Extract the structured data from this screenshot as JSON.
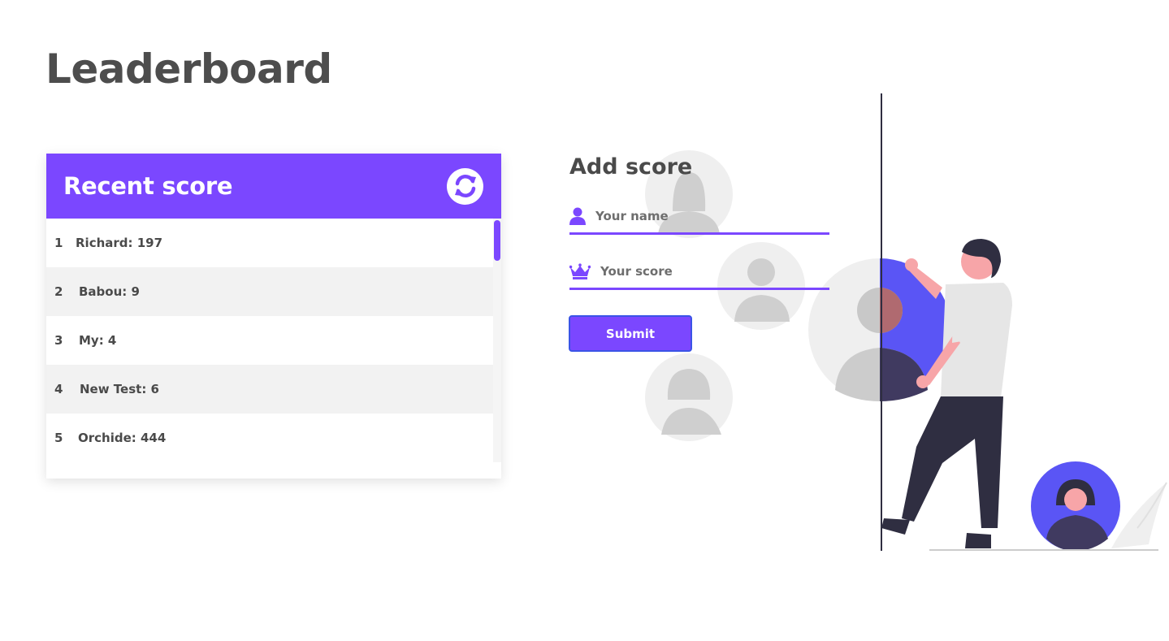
{
  "page": {
    "title": "Leaderboard"
  },
  "recent": {
    "title": "Recent score",
    "refresh_icon": "refresh-icon",
    "scores": [
      {
        "rank": "1",
        "text": "Richard: 197"
      },
      {
        "rank": "2",
        "text": "Babou: 9"
      },
      {
        "rank": "3",
        "text": "My: 4"
      },
      {
        "rank": "4",
        "text": "New Test: 6"
      },
      {
        "rank": "5",
        "text": "Orchide: 444"
      }
    ]
  },
  "form": {
    "title": "Add score",
    "name_placeholder": "Your name",
    "name_icon": "user-icon",
    "score_placeholder": "Your score",
    "score_icon": "crown-icon",
    "submit_label": "Submit"
  },
  "colors": {
    "accent": "#7b47ff",
    "illustration_blue": "#5a55f5",
    "text": "#4a4a4a"
  }
}
